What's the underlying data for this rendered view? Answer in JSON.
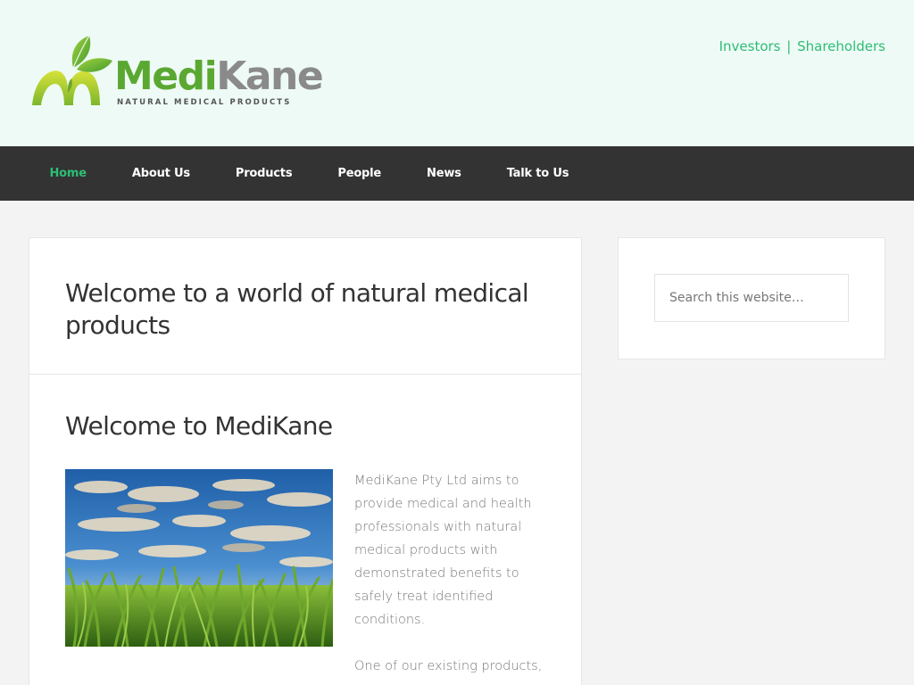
{
  "header": {
    "logo": {
      "brand_part1": "Medi",
      "brand_part2": "Kane",
      "tagline": "NATURAL MEDICAL PRODUCTS"
    },
    "links": [
      {
        "label": "Investors"
      },
      {
        "label": "Shareholders"
      }
    ],
    "link_separator": "|"
  },
  "nav": {
    "items": [
      {
        "label": "Home",
        "active": true
      },
      {
        "label": "About Us"
      },
      {
        "label": "Products"
      },
      {
        "label": "People"
      },
      {
        "label": "News"
      },
      {
        "label": "Talk to Us"
      }
    ]
  },
  "main": {
    "page_title": "Welcome to a world of natural medical products",
    "entry_title": "Welcome to MediKane",
    "paragraphs": [
      "MediKane Pty Ltd aims to provide medical and health professionals with natural medical products with demonstrated benefits to safely treat identified conditions.",
      "One of our existing products,"
    ],
    "image_icon": "sugarcane-field-photo"
  },
  "sidebar": {
    "search": {
      "placeholder": "Search this website…",
      "value": ""
    }
  },
  "colors": {
    "accent": "#2dbd76",
    "nav_bg": "#333333",
    "header_bg": "#eefaf5",
    "page_bg": "#f3f3f3",
    "logo_green": "#5aa832",
    "logo_gray": "#8a8a8a"
  }
}
